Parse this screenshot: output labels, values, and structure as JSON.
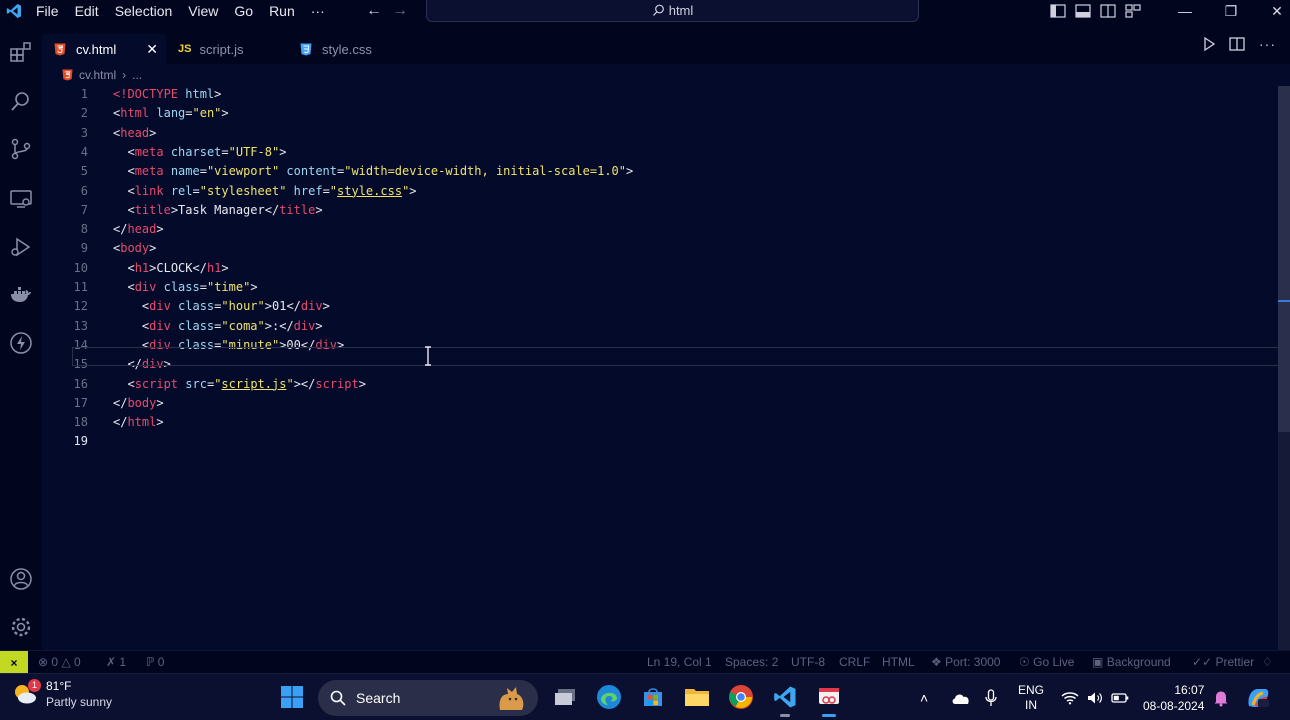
{
  "menu": [
    "File",
    "Edit",
    "Selection",
    "View",
    "Go",
    "Run",
    "···"
  ],
  "command_center": {
    "text": "html"
  },
  "tabs": [
    {
      "label": "cv.html",
      "icon": "html5-icon",
      "active": true
    },
    {
      "label": "script.js",
      "icon": "js-icon",
      "active": false
    },
    {
      "label": "style.css",
      "icon": "css-icon",
      "active": false
    }
  ],
  "tab_icon_text": {
    "js": "JS"
  },
  "breadcrumb": {
    "file": "cv.html",
    "rest": "..."
  },
  "code_lines": [
    [
      [
        "t",
        "<!"
      ],
      [
        "t",
        "DOCTYPE"
      ],
      [
        "a",
        " html"
      ],
      [
        "w",
        ">"
      ]
    ],
    [
      [
        "w",
        "<"
      ],
      [
        "t",
        "html"
      ],
      [
        "a",
        " lang"
      ],
      [
        "w",
        "="
      ],
      [
        "s",
        "\"en\""
      ],
      [
        "w",
        ">"
      ]
    ],
    [
      [
        "w",
        "<"
      ],
      [
        "t",
        "head"
      ],
      [
        "w",
        ">"
      ]
    ],
    [
      [
        "w",
        "  <"
      ],
      [
        "t",
        "meta"
      ],
      [
        "a",
        " charset"
      ],
      [
        "w",
        "="
      ],
      [
        "s",
        "\"UTF-8\""
      ],
      [
        "w",
        ">"
      ]
    ],
    [
      [
        "w",
        "  <"
      ],
      [
        "t",
        "meta"
      ],
      [
        "a",
        " name"
      ],
      [
        "w",
        "="
      ],
      [
        "s",
        "\"viewport\""
      ],
      [
        "a",
        " content"
      ],
      [
        "w",
        "="
      ],
      [
        "s",
        "\"width=device-width, initial-scale=1.0\""
      ],
      [
        "w",
        ">"
      ]
    ],
    [
      [
        "w",
        "  <"
      ],
      [
        "t",
        "link"
      ],
      [
        "a",
        " rel"
      ],
      [
        "w",
        "="
      ],
      [
        "s",
        "\"stylesheet\""
      ],
      [
        "a",
        " href"
      ],
      [
        "w",
        "="
      ],
      [
        "s",
        "\""
      ],
      [
        "su",
        "style.css"
      ],
      [
        "s",
        "\""
      ],
      [
        "w",
        ">"
      ]
    ],
    [
      [
        "w",
        "  <"
      ],
      [
        "t",
        "title"
      ],
      [
        "w",
        ">Task Manager</"
      ],
      [
        "t",
        "title"
      ],
      [
        "w",
        ">"
      ]
    ],
    [
      [
        "w",
        "</"
      ],
      [
        "t",
        "head"
      ],
      [
        "w",
        ">"
      ]
    ],
    [
      [
        "w",
        "<"
      ],
      [
        "t",
        "body"
      ],
      [
        "w",
        ">"
      ]
    ],
    [
      [
        "w",
        "  <"
      ],
      [
        "t",
        "h1"
      ],
      [
        "w",
        ">CLOCK</"
      ],
      [
        "t",
        "h1"
      ],
      [
        "w",
        ">"
      ]
    ],
    [
      [
        "w",
        "  <"
      ],
      [
        "t",
        "div"
      ],
      [
        "a",
        " class"
      ],
      [
        "w",
        "="
      ],
      [
        "s",
        "\"time\""
      ],
      [
        "w",
        ">"
      ]
    ],
    [
      [
        "w",
        "    <"
      ],
      [
        "t",
        "div"
      ],
      [
        "a",
        " class"
      ],
      [
        "w",
        "="
      ],
      [
        "s",
        "\"hour\""
      ],
      [
        "w",
        ">01</"
      ],
      [
        "t",
        "div"
      ],
      [
        "w",
        ">"
      ]
    ],
    [
      [
        "w",
        "    <"
      ],
      [
        "t",
        "div"
      ],
      [
        "a",
        " class"
      ],
      [
        "w",
        "="
      ],
      [
        "s",
        "\"coma\""
      ],
      [
        "w",
        ">:</"
      ],
      [
        "t",
        "div"
      ],
      [
        "w",
        ">"
      ]
    ],
    [
      [
        "w",
        "    <"
      ],
      [
        "t",
        "div"
      ],
      [
        "a",
        " class"
      ],
      [
        "w",
        "="
      ],
      [
        "s",
        "\"minute\""
      ],
      [
        "w",
        ">00</"
      ],
      [
        "t",
        "div"
      ],
      [
        "w",
        ">"
      ]
    ],
    [
      [
        "w",
        "  </"
      ],
      [
        "t",
        "div"
      ],
      [
        "w",
        ">"
      ]
    ],
    [
      [
        "w",
        "  <"
      ],
      [
        "t",
        "script"
      ],
      [
        "a",
        " src"
      ],
      [
        "w",
        "="
      ],
      [
        "s",
        "\""
      ],
      [
        "su",
        "script.js"
      ],
      [
        "s",
        "\""
      ],
      [
        "w",
        "></"
      ],
      [
        "t",
        "script"
      ],
      [
        "w",
        ">"
      ]
    ],
    [
      [
        "w",
        "</"
      ],
      [
        "t",
        "body"
      ],
      [
        "w",
        ">"
      ]
    ],
    [
      [
        "w",
        "</"
      ],
      [
        "t",
        "html"
      ],
      [
        "w",
        ">"
      ]
    ],
    [
      [
        "w",
        ""
      ]
    ]
  ],
  "current_line": 19,
  "statusbar": {
    "errors": "0",
    "warnings": "0",
    "ports_forward": "1",
    "radio": "0",
    "cursor": "Ln 19, Col 1",
    "spaces": "Spaces: 2",
    "encoding": "UTF-8",
    "eol": "CRLF",
    "language": "HTML",
    "port": "Port: 3000",
    "golive": "Go Live",
    "background": "Background",
    "prettier": "Prettier"
  },
  "taskbar": {
    "temperature": "81°F",
    "weather": "Partly sunny",
    "weather_badge": "1",
    "search_placeholder": "Search",
    "lang_top": "ENG",
    "lang_bottom": "IN",
    "time": "16:07",
    "date": "08-08-2024"
  },
  "colors": {
    "tag": "#e84b6e",
    "attr": "#9bd9f2",
    "string": "#f0e36a",
    "text": "#e8e8f0",
    "status_remote": "#c2d924"
  }
}
